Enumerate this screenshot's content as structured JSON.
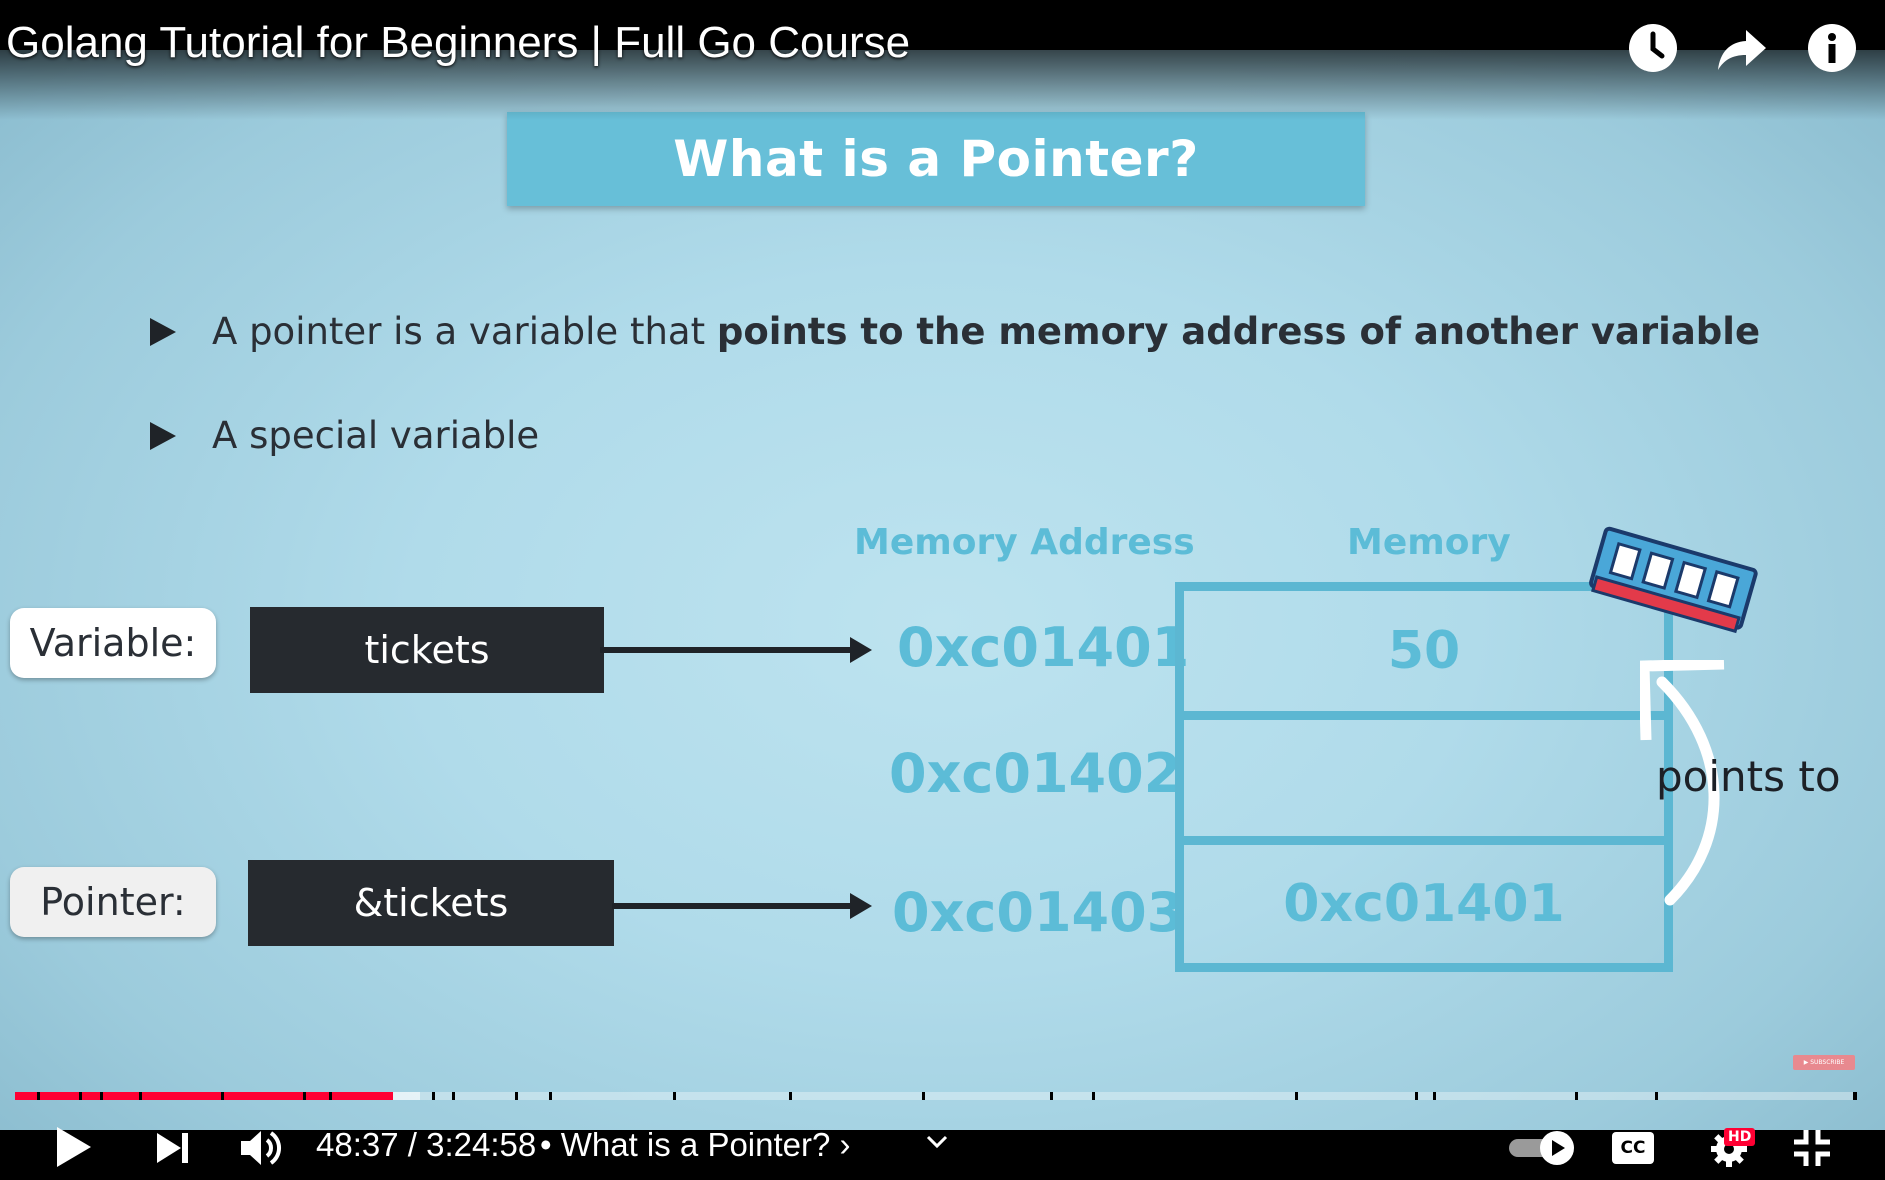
{
  "video": {
    "title": "Golang Tutorial for Beginners | Full Go Course"
  },
  "top_icons": [
    "clock-icon",
    "share-icon",
    "info-icon"
  ],
  "slide": {
    "heading": "What is a Pointer?",
    "bullet1_plain": "A pointer is a variable that ",
    "bullet1_bold": "points to the memory address of another variable",
    "bullet2": "A special variable",
    "memory_address_header": "Memory Address",
    "memory_header": "Memory",
    "variable_label": "Variable:",
    "variable_name": "tickets",
    "pointer_label": "Pointer:",
    "pointer_name": "&tickets",
    "addresses": [
      "0xc01401",
      "0xc01402",
      "0xc01403"
    ],
    "memory_values": [
      "50",
      "",
      "0xc01401"
    ],
    "points_to": "points to"
  },
  "player": {
    "time_current": "48:37",
    "time_separator": " / ",
    "time_total": "3:24:58",
    "chapter_prefix": " • ",
    "chapter": "What is a Pointer?",
    "chapter_chevron": "›",
    "hd_badge": "HD",
    "cc_label": "CC",
    "progress_played_fraction": 0.205,
    "progress_buffered_fraction": 0.22,
    "colors": {
      "played": "#ff0033",
      "accent": "#5cbcd7",
      "heading_bg": "#67bfd8",
      "dark_box": "#262a2f"
    }
  }
}
